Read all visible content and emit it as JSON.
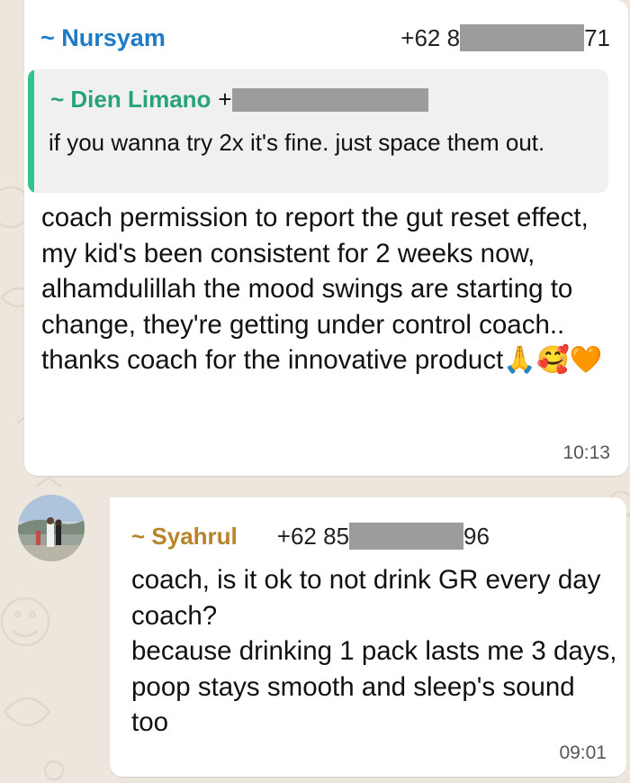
{
  "messages": [
    {
      "sender_name": "~ Nursyam",
      "sender_phone_prefix": "+62 8",
      "sender_phone_suffix": "71",
      "quote": {
        "name": "~ Dien Limano",
        "phone_prefix": "+",
        "text": "if you wanna try 2x it's fine. just space them out."
      },
      "text": "coach permission to report the gut reset effect, my kid's been consistent for 2 weeks now, alhamdulillah the mood swings are starting to change, they're getting under control coach.. thanks coach for the innovative product🙏🥰🧡",
      "time": "10:13"
    },
    {
      "sender_name": "~ Syahrul",
      "sender_phone_prefix": "+62 85",
      "sender_phone_suffix": "96",
      "text": "coach, is it ok to not drink GR every day coach?\nbecause drinking 1 pack lasts me 3 days, poop stays smooth and sleep's sound too",
      "time": "09:01"
    }
  ],
  "colors": {
    "chat_background": "#ede6dd",
    "bubble": "#ffffff",
    "sender_nursyam": "#1f7bc4",
    "sender_dien": "#26a37a",
    "sender_syahrul": "#b8842a",
    "quote_bar": "#2ec38f",
    "redaction": "#9c9c9c"
  },
  "icons": {
    "avatar": "profile-photo-avatar"
  }
}
